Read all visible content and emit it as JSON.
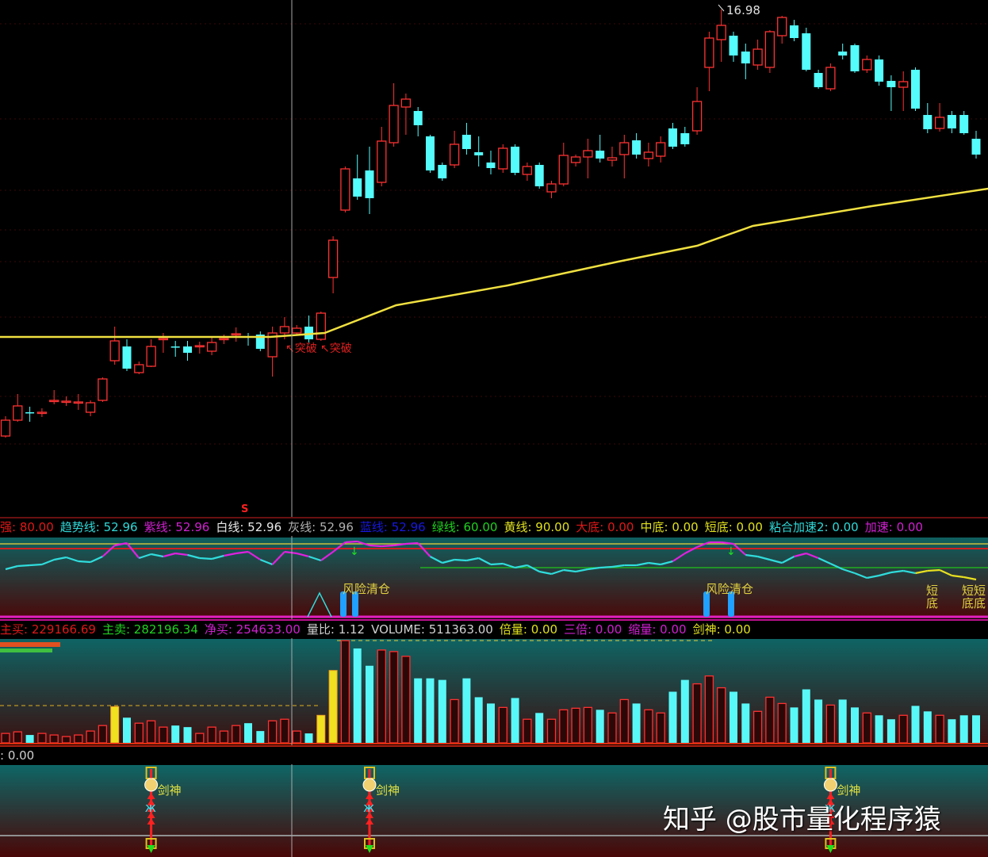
{
  "main_chart": {
    "high_label": "16.98",
    "signal_s": "S",
    "breakout_labels": [
      "突破",
      "突破"
    ],
    "candles": [
      [
        6.22,
        6.62,
        6.72,
        6.18
      ],
      [
        6.62,
        6.98,
        7.28,
        6.58
      ],
      [
        6.82,
        6.8,
        6.96,
        6.58
      ],
      [
        6.82,
        6.82,
        6.92,
        6.7
      ],
      [
        7.1,
        7.12,
        7.38,
        7.02
      ],
      [
        7.08,
        7.1,
        7.22,
        6.98
      ],
      [
        7.06,
        7.08,
        7.28,
        6.88
      ],
      [
        6.82,
        7.06,
        7.12,
        6.72
      ],
      [
        7.12,
        7.66,
        7.7,
        7.08
      ],
      [
        8.12,
        8.62,
        8.98,
        8.02
      ],
      [
        8.48,
        7.92,
        8.66,
        7.86
      ],
      [
        7.82,
        8.02,
        8.1,
        7.78
      ],
      [
        7.98,
        8.48,
        8.66,
        7.96
      ],
      [
        8.66,
        8.68,
        8.82,
        8.32
      ],
      [
        8.48,
        8.46,
        8.62,
        8.22
      ],
      [
        8.48,
        8.32,
        8.62,
        8.12
      ],
      [
        8.48,
        8.5,
        8.6,
        8.3
      ],
      [
        8.36,
        8.58,
        8.72,
        8.26
      ],
      [
        8.66,
        8.68,
        8.78,
        8.54
      ],
      [
        8.78,
        8.8,
        8.96,
        8.6
      ],
      [
        8.74,
        8.7,
        8.82,
        8.5
      ],
      [
        8.78,
        8.42,
        8.86,
        8.36
      ],
      [
        8.22,
        8.82,
        8.98,
        7.72
      ],
      [
        8.82,
        8.98,
        9.22,
        8.66
      ],
      [
        8.82,
        8.94,
        9.02,
        8.78
      ],
      [
        8.98,
        8.66,
        9.26,
        8.58
      ],
      [
        8.66,
        9.32,
        9.36,
        8.62
      ],
      [
        10.22,
        11.16,
        11.26,
        9.82
      ],
      [
        11.92,
        12.96,
        13.02,
        11.86
      ],
      [
        12.72,
        12.26,
        13.32,
        12.18
      ],
      [
        12.92,
        12.22,
        13.52,
        11.82
      ],
      [
        12.62,
        13.66,
        14.02,
        12.52
      ],
      [
        13.62,
        14.56,
        15.12,
        13.52
      ],
      [
        14.52,
        14.72,
        14.86,
        13.82
      ],
      [
        14.42,
        14.06,
        14.52,
        13.78
      ],
      [
        13.78,
        12.92,
        13.82,
        12.86
      ],
      [
        13.06,
        12.72,
        13.12,
        12.66
      ],
      [
        13.06,
        13.58,
        13.92,
        12.98
      ],
      [
        13.82,
        13.46,
        14.12,
        13.32
      ],
      [
        13.38,
        13.3,
        13.78,
        13.02
      ],
      [
        13.12,
        12.98,
        13.42,
        12.82
      ],
      [
        12.96,
        13.48,
        13.58,
        12.86
      ],
      [
        13.52,
        12.86,
        13.58,
        12.8
      ],
      [
        12.82,
        13.02,
        13.12,
        12.66
      ],
      [
        13.06,
        12.52,
        13.12,
        12.46
      ],
      [
        12.38,
        12.58,
        12.66,
        12.22
      ],
      [
        12.58,
        13.3,
        13.62,
        12.52
      ],
      [
        13.12,
        13.26,
        13.32,
        13.02
      ],
      [
        13.26,
        13.42,
        13.72,
        12.72
      ],
      [
        13.42,
        13.22,
        13.82,
        13.12
      ],
      [
        13.18,
        13.24,
        13.52,
        13.02
      ],
      [
        13.32,
        13.62,
        13.82,
        12.72
      ],
      [
        13.68,
        13.32,
        13.86,
        13.22
      ],
      [
        13.22,
        13.38,
        13.62,
        13.02
      ],
      [
        13.28,
        13.62,
        13.78,
        13.12
      ],
      [
        13.98,
        13.52,
        14.12,
        13.46
      ],
      [
        13.86,
        13.58,
        14.02,
        13.52
      ],
      [
        13.92,
        14.66,
        15.02,
        13.82
      ],
      [
        15.52,
        16.26,
        16.42,
        14.92
      ],
      [
        16.22,
        16.58,
        16.98,
        15.66
      ],
      [
        16.32,
        15.82,
        16.42,
        15.66
      ],
      [
        15.92,
        15.62,
        16.12,
        15.22
      ],
      [
        15.58,
        15.98,
        16.22,
        15.46
      ],
      [
        15.52,
        16.42,
        16.46,
        15.38
      ],
      [
        16.32,
        16.78,
        16.82,
        16.12
      ],
      [
        16.58,
        16.26,
        16.72,
        16.18
      ],
      [
        16.38,
        15.46,
        16.52,
        15.42
      ],
      [
        15.38,
        15.02,
        15.46,
        14.98
      ],
      [
        14.98,
        15.52,
        15.62,
        14.92
      ],
      [
        15.92,
        15.82,
        16.12,
        15.72
      ],
      [
        16.08,
        15.42,
        16.12,
        15.38
      ],
      [
        15.46,
        15.72,
        15.82,
        15.38
      ],
      [
        15.72,
        15.16,
        15.82,
        15.06
      ],
      [
        15.18,
        15.02,
        15.32,
        14.42
      ],
      [
        15.02,
        15.16,
        15.42,
        14.42
      ],
      [
        15.46,
        14.48,
        15.52,
        14.42
      ],
      [
        14.32,
        13.96,
        14.62,
        13.86
      ],
      [
        13.98,
        14.26,
        14.62,
        13.9
      ],
      [
        14.32,
        13.98,
        14.42,
        13.86
      ],
      [
        14.32,
        13.86,
        14.42,
        13.82
      ],
      [
        13.72,
        13.32,
        13.92,
        13.22
      ]
    ],
    "ma_line": [
      [
        -0.5,
        8.72
      ],
      [
        21.8,
        8.72
      ],
      [
        26.3,
        8.82
      ],
      [
        32.2,
        9.52
      ],
      [
        41.4,
        10.02
      ],
      [
        50.5,
        10.62
      ],
      [
        57,
        11.02
      ],
      [
        61.6,
        11.52
      ],
      [
        71.4,
        12.02
      ],
      [
        81,
        12.46
      ]
    ],
    "colors": {
      "up": "#ff3232",
      "down": "#54fcfc",
      "ma": "#f0e040"
    }
  },
  "indicator": {
    "header": [
      {
        "label": "强",
        "value": "80.00",
        "color": "#e01818"
      },
      {
        "label": "趋势线",
        "value": "52.96",
        "color": "#30d8d8"
      },
      {
        "label": "紫线",
        "value": "52.96",
        "color": "#d020d0"
      },
      {
        "label": "白线",
        "value": "52.96",
        "color": "#e8e8e8"
      },
      {
        "label": "灰线",
        "value": "52.96",
        "color": "#b0b0b0"
      },
      {
        "label": "蓝线",
        "value": "52.96",
        "color": "#1818e0"
      },
      {
        "label": "绿线",
        "value": "60.00",
        "color": "#20d020"
      },
      {
        "label": "黄线",
        "value": "90.00",
        "color": "#e0e020"
      },
      {
        "label": "大底",
        "value": "0.00",
        "color": "#e01818"
      },
      {
        "label": "中底",
        "value": "0.00",
        "color": "#e0e020"
      },
      {
        "label": "短底",
        "value": "0.00",
        "color": "#e0e020"
      },
      {
        "label": "粘合加速2",
        "value": "0.00",
        "color": "#30d8d8"
      },
      {
        "label": "加速",
        "value": "0.00",
        "color": "#d020d0"
      }
    ],
    "trend": [
      58,
      62,
      63,
      64,
      70,
      73,
      68,
      67,
      74,
      88,
      91,
      72,
      77,
      74,
      78,
      76,
      72,
      71,
      75,
      78,
      80,
      70,
      64,
      80,
      78,
      74,
      69,
      80,
      92,
      93,
      88,
      87,
      88,
      90,
      91,
      74,
      66,
      70,
      69,
      72,
      64,
      65,
      60,
      63,
      55,
      52,
      57,
      55,
      58,
      60,
      61,
      63,
      63,
      66,
      64,
      68,
      78,
      86,
      92,
      92,
      90,
      76,
      74,
      70,
      66,
      74,
      78,
      72,
      65,
      58,
      53,
      47,
      50,
      54,
      56,
      53,
      56,
      57,
      50,
      48,
      45
    ],
    "risk_label": "风险清仓",
    "short_bottom_labels": [
      "短底",
      "短短底底"
    ],
    "levels": {
      "yellow": 90,
      "red": 80,
      "green": 60
    }
  },
  "volume": {
    "header": [
      {
        "label": "主买",
        "value": "229166.69",
        "color": "#e01818"
      },
      {
        "label": "主卖",
        "value": "282196.34",
        "color": "#20d020"
      },
      {
        "label": "净买",
        "value": "254633.00",
        "color": "#d020d0"
      },
      {
        "label": "量比",
        "value": "1.12",
        "color": "#d0d0d0"
      },
      {
        "label": "VOLUME",
        "value": "511363.00",
        "color": "#d0d0d0"
      },
      {
        "label": "倍量",
        "value": "0.00",
        "color": "#e0e020"
      },
      {
        "label": "三倍",
        "value": "0.00",
        "color": "#d020d0"
      },
      {
        "label": "缩量",
        "value": "0.00",
        "color": "#d020d0"
      },
      {
        "label": "剑神",
        "value": "0.00",
        "color": "#e0e020"
      }
    ],
    "values": [
      12,
      14,
      10,
      12,
      10,
      8,
      10,
      15,
      22,
      46,
      32,
      25,
      28,
      20,
      22,
      20,
      12,
      20,
      15,
      22,
      25,
      15,
      28,
      30,
      15,
      12,
      35,
      92,
      130,
      120,
      98,
      118,
      116,
      110,
      82,
      82,
      80,
      55,
      82,
      58,
      50,
      45,
      57,
      30,
      38,
      30,
      42,
      44,
      45,
      42,
      38,
      55,
      50,
      42,
      38,
      65,
      80,
      75,
      85,
      70,
      65,
      50,
      40,
      58,
      50,
      45,
      68,
      55,
      48,
      55,
      45,
      38,
      35,
      30,
      35,
      47,
      40,
      35,
      30,
      35,
      35
    ],
    "highlight_indices": [
      9,
      26,
      27
    ]
  },
  "bottom": {
    "header_value": ": 0.00",
    "signal_label": "剑神",
    "signal_indices": [
      12,
      30,
      68
    ]
  },
  "watermark": "知乎 @股市量化程序猿"
}
